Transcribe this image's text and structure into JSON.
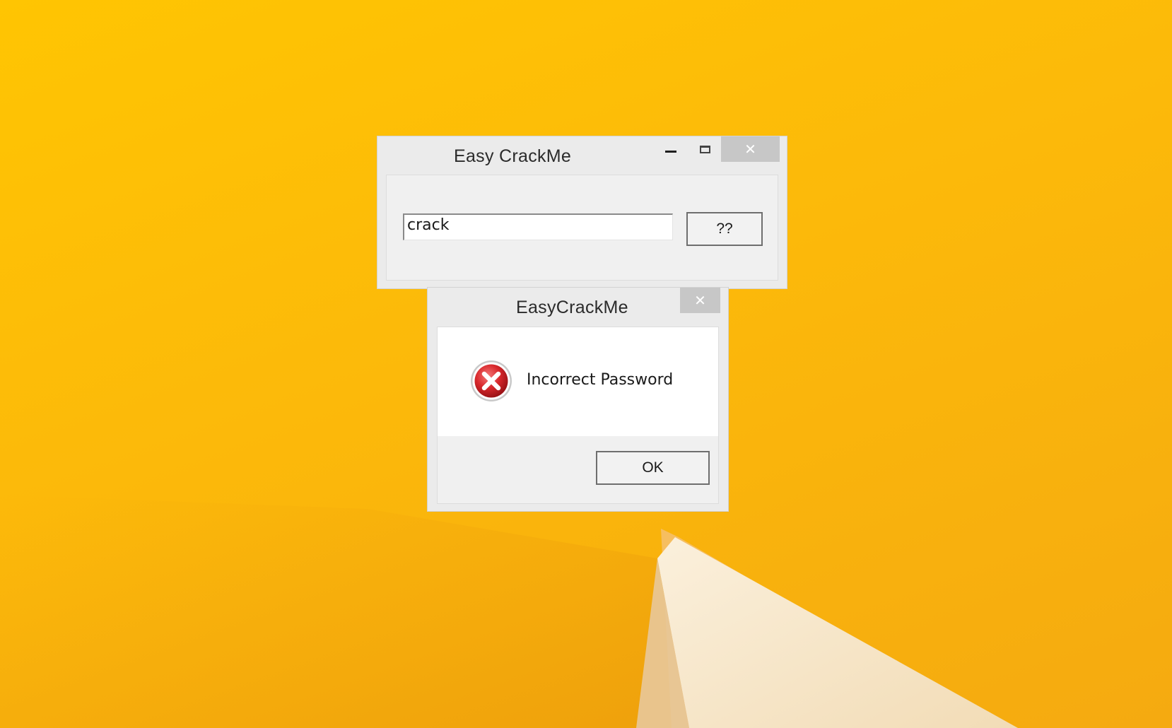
{
  "main_window": {
    "title": "Easy CrackMe",
    "controls": {
      "minimize_icon": "minimize-icon",
      "maximize_icon": "maximize-icon",
      "close_glyph": "✕"
    },
    "input_value": "crack",
    "check_button_label": "??"
  },
  "message_box": {
    "title": "EasyCrackMe",
    "close_glyph": "✕",
    "icon": "error-icon",
    "message": "Incorrect Password",
    "ok_label": "OK"
  },
  "colors": {
    "desktop_accent": "#fcb90a",
    "window_frame": "#ebebeb",
    "close_button": "#c7c7c7",
    "error_red": "#d8282c"
  }
}
